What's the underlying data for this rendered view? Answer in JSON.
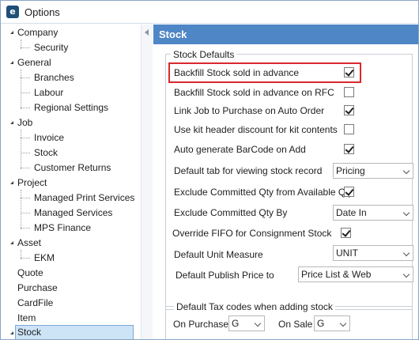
{
  "window": {
    "title": "Options",
    "icon": "app-logo-icon"
  },
  "tree": {
    "items": [
      {
        "label": "Company",
        "level": 0,
        "expanded": true
      },
      {
        "label": "Security",
        "level": 1
      },
      {
        "label": "General",
        "level": 0,
        "expanded": true
      },
      {
        "label": "Branches",
        "level": 1
      },
      {
        "label": "Labour",
        "level": 1
      },
      {
        "label": "Regional Settings",
        "level": 1
      },
      {
        "label": "Job",
        "level": 0,
        "expanded": true
      },
      {
        "label": "Invoice",
        "level": 1
      },
      {
        "label": "Stock",
        "level": 1
      },
      {
        "label": "Customer Returns",
        "level": 1
      },
      {
        "label": "Project",
        "level": 0,
        "expanded": true
      },
      {
        "label": "Managed Print Services",
        "level": 1
      },
      {
        "label": "Managed Services",
        "level": 1
      },
      {
        "label": "MPS Finance",
        "level": 1
      },
      {
        "label": "Asset",
        "level": 0,
        "expanded": true
      },
      {
        "label": "EKM",
        "level": 1
      },
      {
        "label": "Quote",
        "level": 0
      },
      {
        "label": "Purchase",
        "level": 0
      },
      {
        "label": "CardFile",
        "level": 0
      },
      {
        "label": "Item",
        "level": 0
      },
      {
        "label": "Stock",
        "level": 0,
        "selected": true
      }
    ]
  },
  "panel": {
    "title": "Stock",
    "stock_defaults": {
      "group_title": "Stock Defaults",
      "rows": [
        {
          "label": "Backfill Stock sold in advance",
          "type": "checkbox",
          "checked": true,
          "highlighted": true
        },
        {
          "label": "Backfill Stock sold in advance on RFC",
          "type": "checkbox",
          "checked": false
        },
        {
          "label": "Link Job to Purchase on Auto Order",
          "type": "checkbox",
          "checked": true
        },
        {
          "label": "Use kit header discount for kit contents",
          "type": "checkbox",
          "checked": false
        },
        {
          "label": "Auto generate BarCode on Add",
          "type": "checkbox",
          "checked": true
        },
        {
          "label": "Default tab for viewing stock record",
          "type": "select",
          "value": "Pricing"
        },
        {
          "label": "Exclude Committed Qty from Available Qty",
          "type": "checkbox",
          "checked": true
        },
        {
          "label": "Exclude Committed Qty By",
          "type": "select",
          "value": "Date In"
        },
        {
          "label": "Override FIFO for Consignment Stock",
          "type": "checkbox",
          "checked": true
        },
        {
          "label": "Default Unit Measure",
          "type": "select",
          "value": "UNIT"
        },
        {
          "label": "Default Publish Price to",
          "type": "select",
          "value": "Price List & Web"
        }
      ]
    },
    "tax_codes": {
      "group_title": "Default Tax codes when adding stock",
      "on_purchase_label": "On Purchase",
      "on_purchase_value": "G",
      "on_sale_label": "On Sale",
      "on_sale_value": "G"
    }
  },
  "colors": {
    "header_blue": "#4f86c6",
    "highlight_red": "#d9282e",
    "selection_blue": "#cde4f7"
  }
}
